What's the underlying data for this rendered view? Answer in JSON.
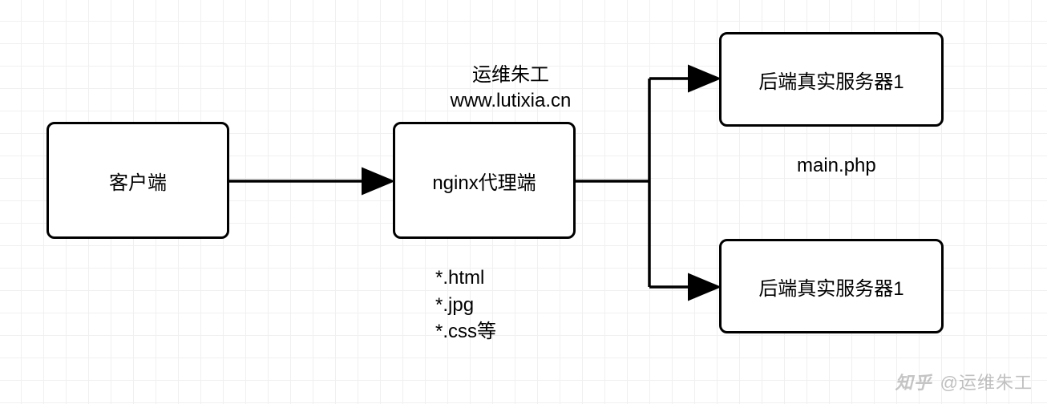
{
  "nodes": {
    "client": {
      "label": "客户端"
    },
    "proxy": {
      "label": "nginx代理端"
    },
    "backend1": {
      "label": "后端真实服务器1"
    },
    "backend2": {
      "label": "后端真实服务器1"
    }
  },
  "labels": {
    "proxy_top": "运维朱工\nwww.lutixia.cn",
    "proxy_bottom": "*.html\n*.jpg\n*.css等",
    "backend1_bottom": "main.php"
  },
  "watermark": {
    "logo": "知乎",
    "text": "@运维朱工"
  }
}
